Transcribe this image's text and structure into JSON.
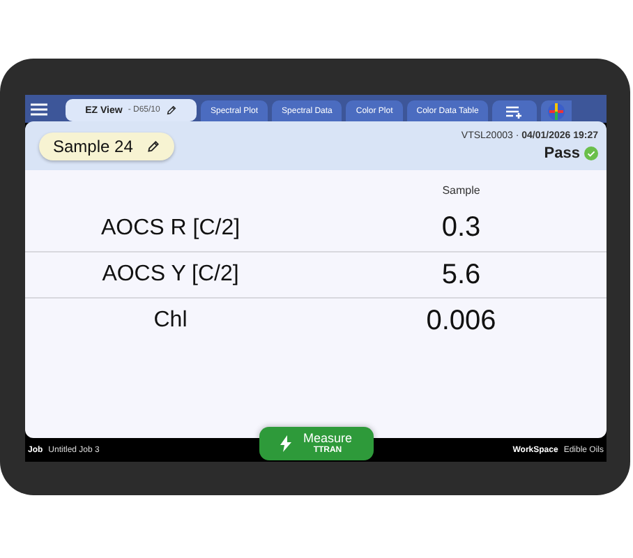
{
  "tabs": [
    {
      "label": "EZ View",
      "sublabel": "- D65/10",
      "selected": true,
      "kind": "editable"
    },
    {
      "label": "Spectral Plot",
      "selected": false,
      "kind": "plain"
    },
    {
      "label": "Spectral Data",
      "selected": false,
      "kind": "plain"
    },
    {
      "label": "Color Plot",
      "selected": false,
      "kind": "plain"
    },
    {
      "label": "Color Data Table",
      "selected": false,
      "kind": "plain"
    }
  ],
  "header": {
    "sample": "Sample 24",
    "meta": "VTSL20003 · **04/01/2026 19:27**",
    "status": "Pass",
    "passed": true
  },
  "table": {
    "columns": [
      "Sample"
    ],
    "rows": [
      {
        "label": "AOCS R [C/2]",
        "value": "0.3"
      },
      {
        "label": "AOCS Y [C/2]",
        "value": "5.6"
      },
      {
        "label": "Chl",
        "value": "0.006"
      }
    ]
  },
  "footer": {
    "job_label": "Job",
    "job": "Untitled Job 3",
    "workspace_label": "WorkSpace",
    "workspace": "Edible Oils"
  },
  "measure": {
    "label": "Measure",
    "mode": "TTRAN"
  }
}
